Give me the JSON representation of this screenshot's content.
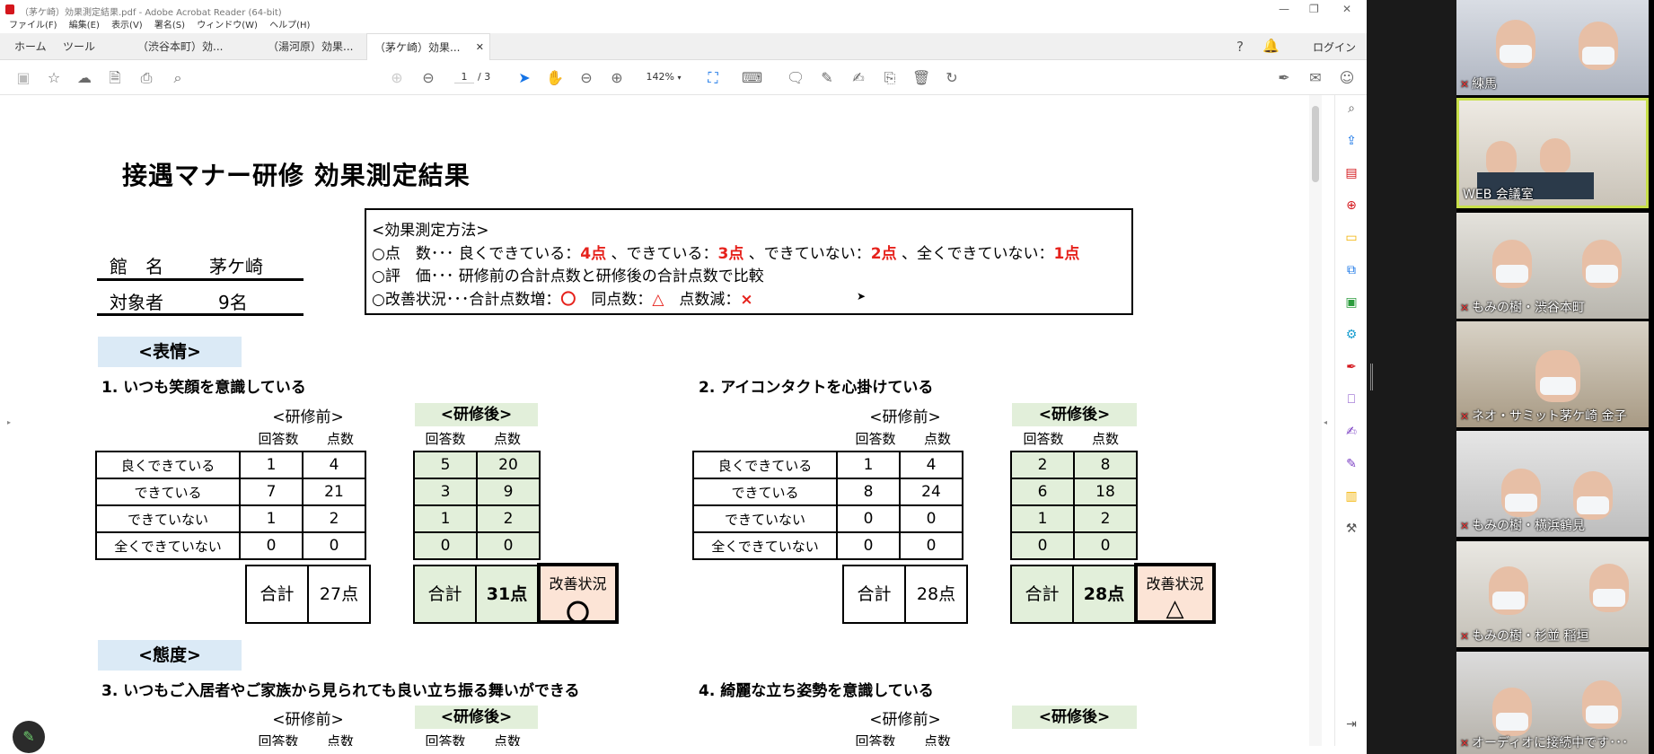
{
  "window": {
    "title": "（茅ケ崎）効果測定結果.pdf - Adobe Acrobat Reader (64-bit)",
    "menu": [
      "ファイル(F)",
      "編集(E)",
      "表示(V)",
      "署名(S)",
      "ウィンドウ(W)",
      "ヘルプ(H)"
    ]
  },
  "tabs": {
    "home": "ホーム",
    "tools": "ツール",
    "doc_tabs": [
      "（渋谷本町）効...",
      "（湯河原）効果...",
      "（茅ケ崎）効果..."
    ],
    "login": "ログイン"
  },
  "toolbar": {
    "page_current": "1",
    "page_total": "/ 3",
    "zoom": "142%"
  },
  "doc": {
    "title": "接遇マナー研修  効果測定結果",
    "facility_label": "館　名",
    "facility_value": "茅ケ崎",
    "target_label": "対象者",
    "target_value": "9名",
    "method": {
      "heading": "<効果測定方法>",
      "line1_prefix": "○点　数･･･ 良くできている：",
      "line1_v1": "4点",
      "line1_mid1": " 、できている：",
      "line1_v2": "3点",
      "line1_mid2": " 、できていない：",
      "line1_v3": "2点",
      "line1_mid3": " 、全くできていない：",
      "line1_v4": "1点",
      "line2": "○評　価･･･ 研修前の合計点数と研修後の合計点数で比較",
      "line3_prefix": "○改善状況･･･合計点数増：",
      "line3_v1": "〇",
      "line3_mid1": "　同点数：",
      "line3_v2": "△",
      "line3_mid2": "　点数減：",
      "line3_v3": "×"
    },
    "section1": "<表情>",
    "section2": "<態度>",
    "labels": {
      "before": "<研修前>",
      "after": "<研修後>",
      "answers": "回答数",
      "points": "点数",
      "total": "合計",
      "improvement": "改善状況",
      "rows": [
        "良くできている",
        "できている",
        "できていない",
        "全くできていない"
      ]
    },
    "q1": {
      "title": "1. いつも笑顔を意識している",
      "before": [
        [
          "1",
          "4"
        ],
        [
          "7",
          "21"
        ],
        [
          "1",
          "2"
        ],
        [
          "0",
          "0"
        ]
      ],
      "before_total": "27点",
      "after": [
        [
          "5",
          "20"
        ],
        [
          "3",
          "9"
        ],
        [
          "1",
          "2"
        ],
        [
          "0",
          "0"
        ]
      ],
      "after_total": "31点",
      "status": "〇"
    },
    "q2": {
      "title": "2. アイコンタクトを心掛けている",
      "before": [
        [
          "1",
          "4"
        ],
        [
          "8",
          "24"
        ],
        [
          "0",
          "0"
        ],
        [
          "0",
          "0"
        ]
      ],
      "before_total": "28点",
      "after": [
        [
          "2",
          "8"
        ],
        [
          "6",
          "18"
        ],
        [
          "1",
          "2"
        ],
        [
          "0",
          "0"
        ]
      ],
      "after_total": "28点",
      "status": "△"
    },
    "q3": {
      "title": "3. いつもご入居者やご家族から見られても良い立ち振る舞いができる"
    },
    "q4": {
      "title": "4. 綺麗な立ち姿勢を意識している"
    }
  },
  "participants": [
    "練馬",
    "WEB 会議室",
    "もみの樹・渋谷本町",
    "ネオ・サミット茅ケ崎 金子",
    "もみの樹・横浜鶴見",
    "もみの樹・杉並 稲垣",
    "オーディオに接続中です･･･"
  ],
  "colors": {
    "accent_red": "#e6221c",
    "after_green": "#e2efda",
    "section_blue": "#dbeaf6",
    "improvement_peach": "#fce4d6",
    "selected_tile": "#c8e04a"
  }
}
